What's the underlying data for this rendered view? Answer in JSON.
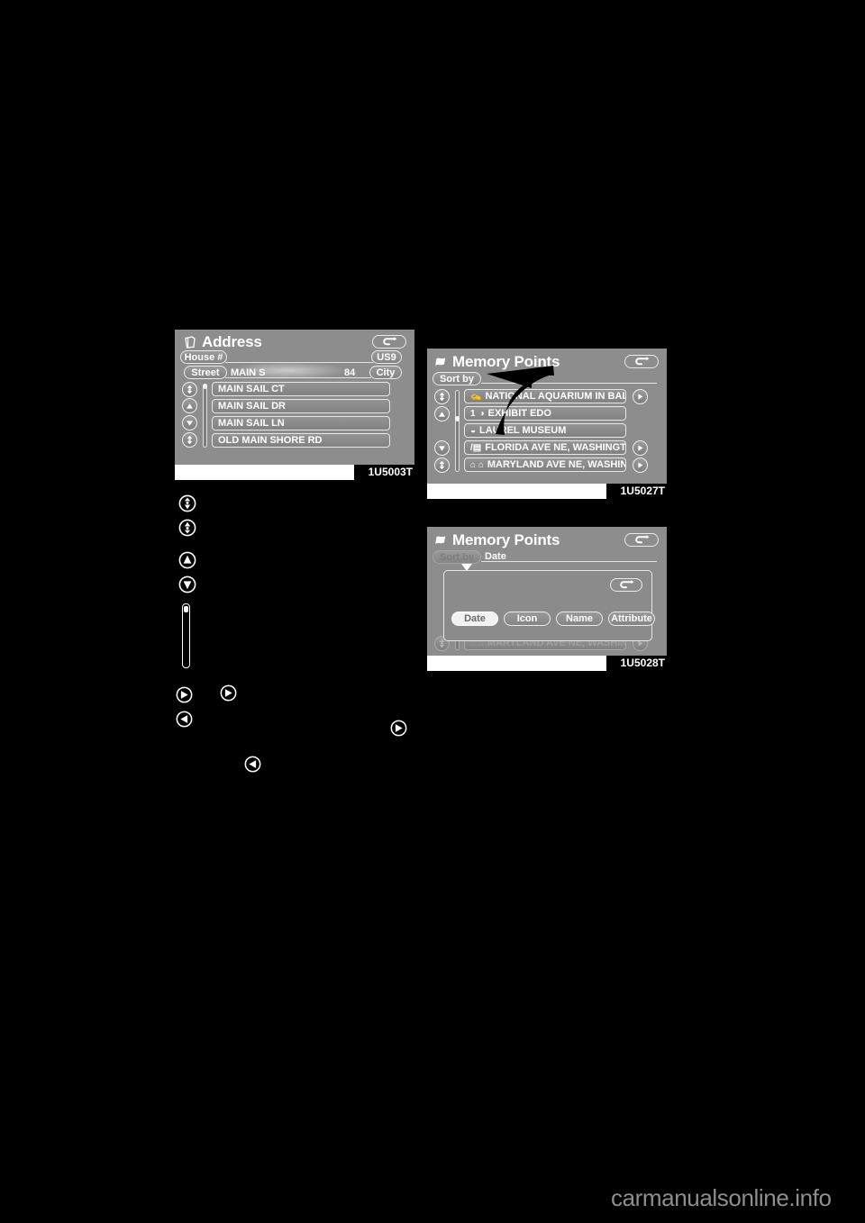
{
  "page": {
    "background_color": "#000000",
    "watermark": "carmanualsonline.info"
  },
  "screens": [
    {
      "id": "address",
      "caption_code": "1U5003T",
      "title": "Address",
      "title_icon": "address-book-icon",
      "return_icon": "return-arrow-icon",
      "buttons": {
        "house_number": "House #",
        "street": "Street",
        "state": "US9",
        "city": "City"
      },
      "fields": {
        "street_value": "MAIN S",
        "house_value": "84",
        "house_number_value": ""
      },
      "scroll_icons": {
        "page_up": "page-up-icon",
        "up": "up-arrow-icon",
        "down": "down-arrow-icon",
        "page_down": "page-down-icon"
      },
      "list": [
        {
          "label": "MAIN SAIL CT"
        },
        {
          "label": "MAIN SAIL DR"
        },
        {
          "label": "MAIN SAIL LN"
        },
        {
          "label": "OLD MAIN SHORE RD"
        }
      ]
    },
    {
      "id": "memory-points",
      "caption_code": "1U5027T",
      "title": "Memory Points",
      "title_icon": "flag-icon",
      "return_icon": "return-arrow-icon",
      "sort_by_label": "Sort by",
      "annotation": "callout-arrow-to-sort-by",
      "list": [
        {
          "lead": "",
          "mark": "✍",
          "label": "NATIONAL AQUARIUM IN BALTIM",
          "has_detail": true
        },
        {
          "lead": "1",
          "mark": "◑",
          "label": "EXHIBIT EDO",
          "has_detail": false
        },
        {
          "lead": "",
          "mark": "◒",
          "label": "LAUREL MUSEUM",
          "has_detail": false
        },
        {
          "lead": "",
          "mark": "/▤",
          "label": "FLORIDA AVE NE, WASHINGTON, D",
          "has_detail": true
        },
        {
          "lead": "",
          "mark": "⌂ ⌂",
          "label": "MARYLAND AVE NE, WASHINGTO",
          "has_detail": true
        }
      ]
    },
    {
      "id": "memory-points-sort",
      "caption_code": "1U5028T",
      "title": "Memory Points",
      "title_icon": "flag-icon",
      "return_icon": "return-arrow-icon",
      "sort_by_label": "Sort by",
      "sort_by_value": "Date",
      "popup": {
        "return_icon": "return-arrow-icon",
        "options": [
          {
            "label": "Date",
            "selected": true
          },
          {
            "label": "Icon",
            "selected": false
          },
          {
            "label": "Name",
            "selected": false
          },
          {
            "label": "Attribute",
            "selected": false
          }
        ]
      },
      "background_row": {
        "mark": "⌂ ⌂",
        "label": "MARYLAND AVE NE, WASHINGTO",
        "has_detail": true
      }
    }
  ],
  "inline_icons": [
    {
      "name": "page-up-icon",
      "kind": "page-up"
    },
    {
      "name": "page-down-icon",
      "kind": "page-down"
    },
    {
      "name": "up-arrow-icon",
      "kind": "up"
    },
    {
      "name": "down-arrow-icon",
      "kind": "down"
    },
    {
      "name": "scrollbar-icon",
      "kind": "scrollbar"
    },
    {
      "name": "right-arrow-icon-a",
      "kind": "right"
    },
    {
      "name": "right-arrow-icon-b",
      "kind": "right"
    },
    {
      "name": "left-arrow-icon-a",
      "kind": "left"
    },
    {
      "name": "right-arrow-icon-c",
      "kind": "right"
    },
    {
      "name": "left-arrow-icon-b",
      "kind": "left"
    }
  ]
}
